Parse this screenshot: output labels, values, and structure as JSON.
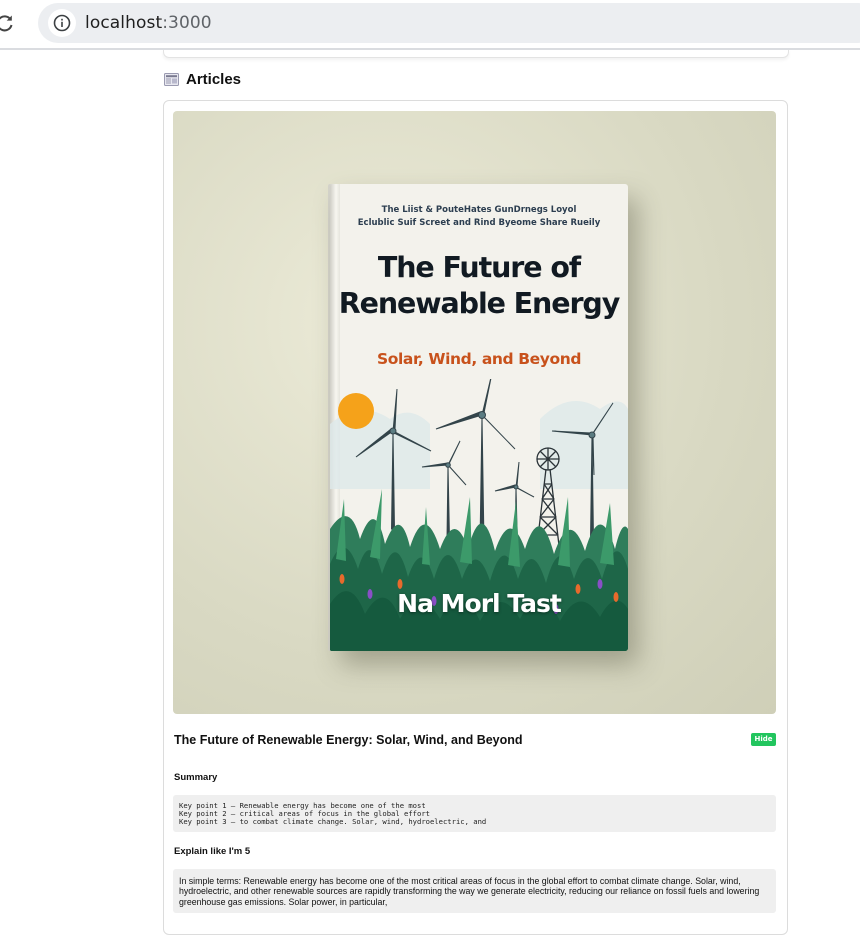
{
  "browser": {
    "url_host": "localhost",
    "url_port": ":3000"
  },
  "section": {
    "title": "Articles"
  },
  "article": {
    "cover": {
      "tagline_line1": "The Liist & PouteHates GunDrnegs Loyol",
      "tagline_line2": "Eclublic Suif Screet and Rind Byeome Share Rueily",
      "title_line1": "The Future of",
      "title_line2": "Renewable Energy",
      "subtitle": "Solar, Wind, and Beyond",
      "author": "Na Morl Tast"
    },
    "title": "The Future of Renewable Energy: Solar, Wind, and Beyond",
    "hide_label": "Hide",
    "summary_heading": "Summary",
    "summary_points": [
      "Key point 1 – Renewable energy has become one of the most",
      "Key point 2 – critical areas of focus in the global effort",
      "Key point 3 – to combat climate change. Solar, wind, hydroelectric, and"
    ],
    "eli5_heading": "Explain like I'm 5",
    "eli5_text": "In simple terms: Renewable energy has become one of the most critical areas of focus in the global effort to combat climate change. Solar, wind, hydroelectric, and other renewable sources are rapidly transforming the way we generate electricity, reducing our reliance on fossil fuels and lowering greenhouse gas emissions. Solar power, in particular,"
  },
  "colors": {
    "accent_green": "#22c55e",
    "cover_subtitle": "#c8521c",
    "sun": "#f5a21a"
  }
}
